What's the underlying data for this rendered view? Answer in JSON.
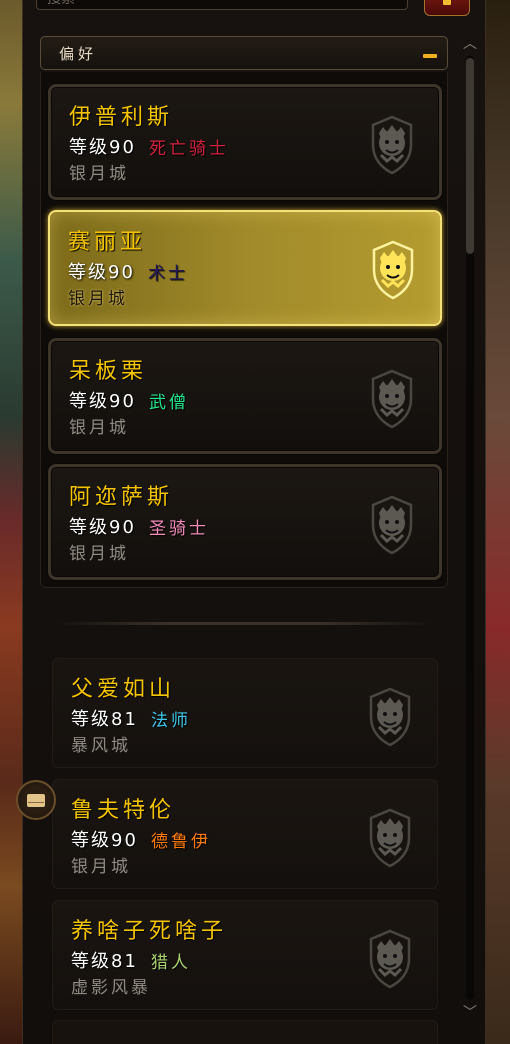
{
  "search": {
    "placeholder": "搜索"
  },
  "group": {
    "title": "偏好"
  },
  "favorites": [
    {
      "name": "伊普利斯",
      "level": "等级90",
      "class": "死亡骑士",
      "class_color": "#d4213b",
      "realm": "银月城",
      "selected": false
    },
    {
      "name": "赛丽亚",
      "level": "等级90",
      "class": "术士",
      "class_color": "#c6b8ff",
      "realm": "银月城",
      "selected": true
    },
    {
      "name": "呆板栗",
      "level": "等级90",
      "class": "武僧",
      "class_color": "#23e58a",
      "realm": "银月城",
      "selected": false
    },
    {
      "name": "阿迩萨斯",
      "level": "等级90",
      "class": "圣骑士",
      "class_color": "#f48cba",
      "realm": "银月城",
      "selected": false
    }
  ],
  "others": [
    {
      "name": "父爱如山",
      "level": "等级81",
      "class": "法师",
      "class_color": "#3fc7eb",
      "realm": "暴风城"
    },
    {
      "name": "鲁夫特伦",
      "level": "等级90",
      "class": "德鲁伊",
      "class_color": "#ff7c0a",
      "realm": "银月城"
    },
    {
      "name": "养啥子死啥子",
      "level": "等级81",
      "class": "猎人",
      "class_color": "#aad372",
      "realm": "虚影风暴"
    }
  ],
  "icons": {
    "faction": "alliance-lion-icon",
    "mail": "mail-icon"
  }
}
